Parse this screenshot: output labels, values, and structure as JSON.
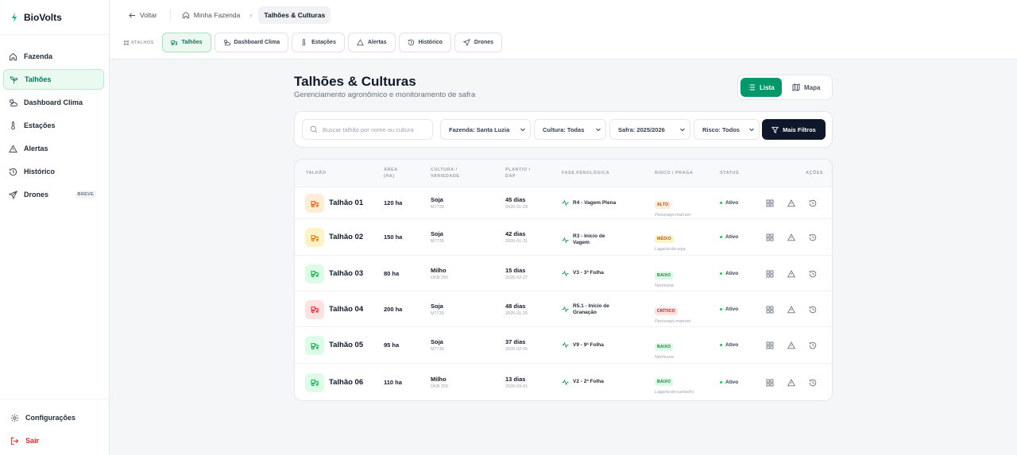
{
  "brand": {
    "name": "BioVolts"
  },
  "colors": {
    "accent": "#059669",
    "dark": "#0f172a",
    "danger": "#dc2626"
  },
  "sidebar": {
    "items": [
      {
        "label": "Fazenda",
        "icon": "home-icon",
        "active": false
      },
      {
        "label": "Talhões",
        "icon": "sprout-icon",
        "active": true
      },
      {
        "label": "Dashboard Clima",
        "icon": "cloud-sun-icon",
        "active": false
      },
      {
        "label": "Estações",
        "icon": "thermometer-icon",
        "active": false
      },
      {
        "label": "Alertas",
        "icon": "alert-triangle-icon",
        "active": false
      },
      {
        "label": "Histórico",
        "icon": "history-icon",
        "active": false
      },
      {
        "label": "Drones",
        "icon": "send-icon",
        "active": false,
        "badge": "BREVE"
      }
    ],
    "settings_label": "Configurações",
    "logout_label": "Sair"
  },
  "breadcrumb": {
    "back_label": "Voltar",
    "home_label": "Minha Fazenda",
    "current_label": "Talhões & Culturas"
  },
  "shortcuts": {
    "label": "ATALHOS",
    "items": [
      {
        "label": "Talhões",
        "active": true
      },
      {
        "label": "Dashboard Clima",
        "active": false
      },
      {
        "label": "Estações",
        "active": false
      },
      {
        "label": "Alertas",
        "active": false
      },
      {
        "label": "Histórico",
        "active": false
      },
      {
        "label": "Drones",
        "active": false
      }
    ]
  },
  "page": {
    "title": "Talhões & Culturas",
    "subtitle": "Gerenciamento agronômico e monitoramento de safra"
  },
  "view_toggle": {
    "list_label": "Lista",
    "map_label": "Mapa",
    "selected": "Lista"
  },
  "filters": {
    "search_placeholder": "Buscar talhão por nome ou cultura",
    "search_value": "",
    "fazenda": "Fazenda: Santa Luzia",
    "cultura": "Cultura: Todas",
    "safra": "Safra: 2025/2026",
    "risco": "Risco: Todos",
    "more_label": "Mais Filtros"
  },
  "table": {
    "headers": {
      "talhao": "TALHÃO",
      "area": "ÁREA (HA)",
      "cultura": "CULTURA / VARIEDADE",
      "plantio": "PLANTIO / DAP",
      "fase": "FASE FENOLÓGICA",
      "risco": "RISCO / PRAGA",
      "status": "STATUS",
      "acoes": "AÇÕES"
    },
    "rows": [
      {
        "name": "Talhão 01",
        "area": "120 ha",
        "crop": "Soja",
        "variety": "M7739",
        "days": "45 dias",
        "date": "2026-01-28",
        "phase": "R4 - Vagem Plena",
        "risk": "ALTO",
        "risk_level": "alto",
        "pest": "Percevejo-marrom",
        "status": "Ativo",
        "icon_color": "#ea580c",
        "icon_bg": "#ffedd5"
      },
      {
        "name": "Talhão 02",
        "area": "150 ha",
        "crop": "Soja",
        "variety": "M7739",
        "days": "42 dias",
        "date": "2026-01-31",
        "phase": "R3 - Início de Vagem",
        "risk": "MÉDIO",
        "risk_level": "medio",
        "pest": "Lagarta-da-soja",
        "status": "Ativo",
        "icon_color": "#d97706",
        "icon_bg": "#fef3c7"
      },
      {
        "name": "Talhão 03",
        "area": "80 ha",
        "crop": "Milho",
        "variety": "DKB 255",
        "days": "15 dias",
        "date": "2026-02-27",
        "phase": "V3 - 3ª Folha",
        "risk": "BAIXO",
        "risk_level": "baixo",
        "pest": "Nenhuma",
        "status": "Ativo",
        "icon_color": "#16a34a",
        "icon_bg": "#dcfce7"
      },
      {
        "name": "Talhão 04",
        "area": "200 ha",
        "crop": "Soja",
        "variety": "M7739",
        "days": "48 dias",
        "date": "2026-01-25",
        "phase": "R5.1 - Início de Granação",
        "risk": "CRÍTICO",
        "risk_level": "critico",
        "pest": "Percevejo-marrom",
        "status": "Ativo",
        "icon_color": "#dc2626",
        "icon_bg": "#fee2e2"
      },
      {
        "name": "Talhão 05",
        "area": "95 ha",
        "crop": "Soja",
        "variety": "M7739",
        "days": "37 dias",
        "date": "2026-02-05",
        "phase": "V9 - 9ª Folha",
        "risk": "BAIXO",
        "risk_level": "baixo",
        "pest": "Nenhuma",
        "status": "Ativo",
        "icon_color": "#16a34a",
        "icon_bg": "#dcfce7"
      },
      {
        "name": "Talhão 06",
        "area": "110 ha",
        "crop": "Milho",
        "variety": "DKB 255",
        "days": "13 dias",
        "date": "2026-03-01",
        "phase": "V2 - 2ª Folha",
        "risk": "BAIXO",
        "risk_level": "baixo",
        "pest": "Lagarta-do-cartucho",
        "status": "Ativo",
        "icon_color": "#16a34a",
        "icon_bg": "#dcfce7"
      }
    ]
  }
}
